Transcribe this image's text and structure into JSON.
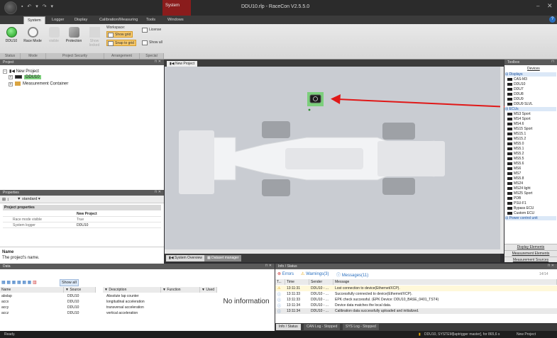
{
  "window": {
    "title": "DDU10.rlp - RaceCon V2.5.5.0",
    "context_tab": "System"
  },
  "ribbon_tabs": [
    "System",
    "Logger",
    "Display",
    "Calibration/Measuring",
    "Tools",
    "Windows"
  ],
  "ribbon": {
    "ddu_label": "DDU10",
    "race_mode_label": "Race Mode",
    "visible_label": "visible",
    "protection_label": "Protection",
    "show_locked_label": "Show locked",
    "workspace_label": "Workspace:",
    "show_grid_label": "Show grid",
    "snap_to_grid_label": "Snap to grid",
    "license_label": "License",
    "show_all_label": "Show all",
    "groups": [
      "Status",
      "Mode",
      "Project Security",
      "Arrangement",
      "Special"
    ]
  },
  "project_panel": {
    "title": "Project",
    "items": [
      "New Project",
      "DDU10",
      "Measurement Container"
    ]
  },
  "properties_panel": {
    "title": "Properties",
    "toolbar_filter": "standard",
    "section": "Project properties",
    "rows": [
      {
        "name": "",
        "value": "New Project"
      },
      {
        "name": "Race mode visible",
        "value": "True"
      },
      {
        "name": "System logger",
        "value": "DDU10"
      }
    ],
    "desc_title": "Name",
    "desc_text": "The project's name."
  },
  "doc_tab": "New Project",
  "bottom_tabs": [
    "System Overview",
    "Dataset manager"
  ],
  "toolbox": {
    "title": "Toolbox",
    "devices_label": "Devices",
    "categories": [
      "Displays",
      "ECUs",
      "Power control unit"
    ],
    "displays": [
      "CAS-M3",
      "DDU10",
      "DDU7",
      "DDU8",
      "DDU9",
      "DDU9 SLVL"
    ],
    "ecus": [
      "MS3 Sport",
      "MS4 Sport",
      "MS4.6",
      "MS15 Sport",
      "MS15.1",
      "MS15.2",
      "MS5.0",
      "MS5.1",
      "MS5.2",
      "MS5.5",
      "MS5.6",
      "MS6",
      "MS7",
      "MS5.8",
      "MS24",
      "MS24 light",
      "MS25 Sport",
      "PDB",
      "PSU-F1",
      "Bypass ECU",
      "Custom ECU"
    ],
    "footer": [
      "Display Elements",
      "Measurement Elements",
      "Measurement Sources"
    ]
  },
  "data_panel": {
    "title": "Data",
    "show_all": "Show all",
    "columns": [
      "Name",
      "Source",
      "Description",
      "Function",
      "Used"
    ],
    "rows": [
      {
        "name": "abslap",
        "source": "DDU10",
        "desc": "Absolute lap counter"
      },
      {
        "name": "accx",
        "source": "DDU10",
        "desc": "longitudinal acceleration"
      },
      {
        "name": "accy",
        "source": "DDU10",
        "desc": "transversal acceleration"
      },
      {
        "name": "accz",
        "source": "DDU10",
        "desc": "vertical acceleration"
      }
    ],
    "no_info": "No information"
  },
  "status_panel": {
    "title": "Info / Status",
    "errors": "Errors",
    "warnings": "Warnings(3)",
    "messages": "Messages(11)",
    "counter": "14/14",
    "columns": [
      "T...",
      "Time",
      "Sender",
      "Message"
    ],
    "rows": [
      {
        "time": "13:11:31",
        "sender": "DDU10 - ...",
        "msg": "Lost connection to device(Ethernet/XCP)."
      },
      {
        "time": "13:11:33",
        "sender": "DDU10 - ...",
        "msg": "Successfully connected to device(Ethernet/XCP)."
      },
      {
        "time": "13:11:33",
        "sender": "DDU10 - ...",
        "msg": "EPK check successful. (EPK Device: DDU10_BASE_0401_TST4)"
      },
      {
        "time": "13:11:34",
        "sender": "DDU10 - ...",
        "msg": "Device data matches the local data."
      },
      {
        "time": "13:11:34",
        "sender": "DDU10 - ...",
        "msg": "Calibration data successfully uploaded and initialized."
      }
    ],
    "tabs": [
      "Info / Status",
      "CAN Log - Stopped",
      "SYS Log - Stopped"
    ]
  },
  "statusbar": {
    "left": "Ready.",
    "right": "DDU10, SYSTEM[laptrigger master], for 865,6 s",
    "project": "New Project"
  },
  "colors": {
    "accent_green": "#6cc26c",
    "arrow_red": "#e01818",
    "context_red": "#8a1c1c"
  }
}
